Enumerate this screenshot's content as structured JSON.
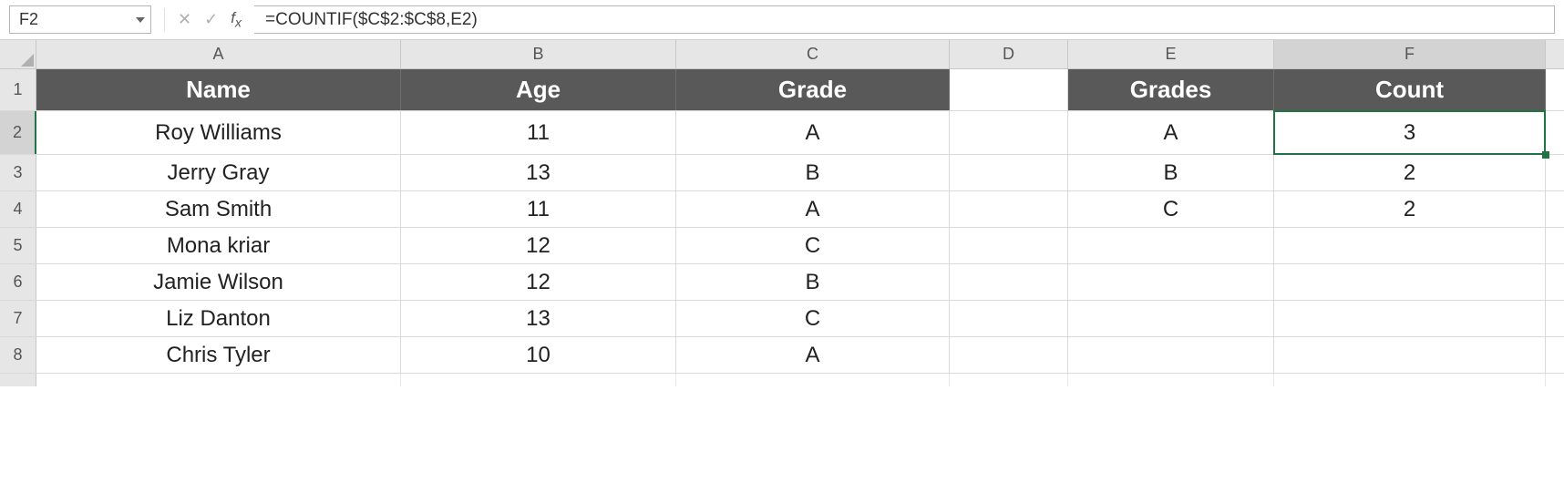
{
  "formula_bar": {
    "cell_ref": "F2",
    "formula": "=COUNTIF($C$2:$C$8,E2)"
  },
  "columns": {
    "A": "A",
    "B": "B",
    "C": "C",
    "D": "D",
    "E": "E",
    "F": "F"
  },
  "row_numbers": [
    "1",
    "2",
    "3",
    "4",
    "5",
    "6",
    "7",
    "8"
  ],
  "headers": {
    "name": "Name",
    "age": "Age",
    "grade": "Grade",
    "grades": "Grades",
    "count": "Count"
  },
  "students": [
    {
      "name": "Roy Williams",
      "age": "11",
      "grade": "A"
    },
    {
      "name": "Jerry Gray",
      "age": "13",
      "grade": "B"
    },
    {
      "name": "Sam Smith",
      "age": "11",
      "grade": "A"
    },
    {
      "name": "Mona kriar",
      "age": "12",
      "grade": "C"
    },
    {
      "name": "Jamie Wilson",
      "age": "12",
      "grade": "B"
    },
    {
      "name": "Liz Danton",
      "age": "13",
      "grade": "C"
    },
    {
      "name": "Chris Tyler",
      "age": "10",
      "grade": "A"
    }
  ],
  "summary": [
    {
      "grade": "A",
      "count": "3"
    },
    {
      "grade": "B",
      "count": "2"
    },
    {
      "grade": "C",
      "count": "2"
    }
  ],
  "selected_cell": "F2"
}
